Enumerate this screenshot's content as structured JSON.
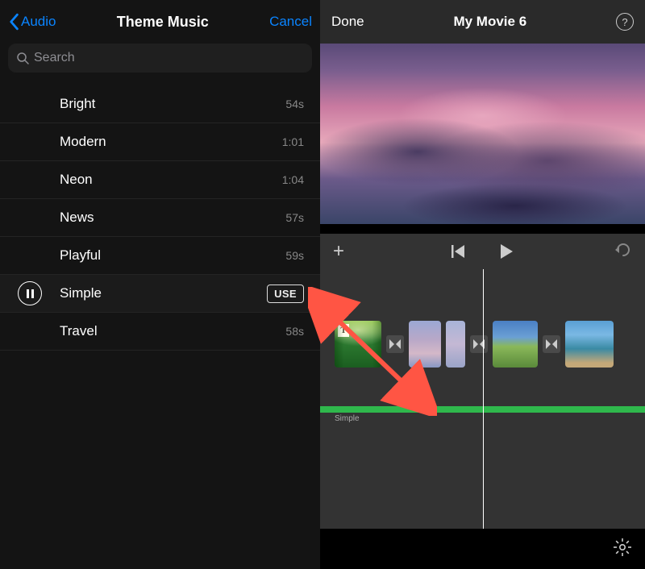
{
  "left": {
    "back_label": "Audio",
    "title": "Theme Music",
    "cancel_label": "Cancel",
    "search_placeholder": "Search",
    "tracks": [
      {
        "name": "Bright",
        "duration": "54s",
        "selected": false
      },
      {
        "name": "Modern",
        "duration": "1:01",
        "selected": false
      },
      {
        "name": "Neon",
        "duration": "1:04",
        "selected": false
      },
      {
        "name": "News",
        "duration": "57s",
        "selected": false
      },
      {
        "name": "Playful",
        "duration": "59s",
        "selected": false
      },
      {
        "name": "Simple",
        "duration": "",
        "selected": true
      },
      {
        "name": "Travel",
        "duration": "58s",
        "selected": false
      }
    ],
    "use_label": "USE"
  },
  "right": {
    "done_label": "Done",
    "title": "My Movie 6",
    "help_label": "?",
    "audio_track_label": "Simple",
    "title_badge": "T"
  }
}
